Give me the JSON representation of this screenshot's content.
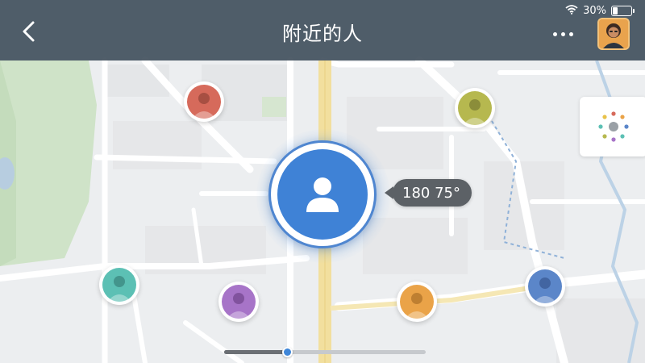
{
  "status_bar": {
    "signal_icon": "wifi-icon",
    "battery_text": "30%",
    "battery_level": 0.3
  },
  "header": {
    "title": "附近的人",
    "back_icon": "chevron-left-icon",
    "more_icon": "more-dots-icon",
    "avatar": "profile-avatar"
  },
  "map": {
    "side_button_icon": "people-radar-icon",
    "self_marker": {
      "icon": "person-icon",
      "color": "#3f82d6",
      "bubble_text": "180 75°"
    },
    "people": [
      {
        "id": "red",
        "color": "#d66a5b"
      },
      {
        "id": "olive",
        "color": "#b6b84f"
      },
      {
        "id": "teal",
        "color": "#5cc0b4"
      },
      {
        "id": "purple",
        "color": "#a774c8"
      },
      {
        "id": "orange",
        "color": "#eaa348"
      },
      {
        "id": "blue",
        "color": "#5b86c9"
      }
    ]
  },
  "slider": {
    "value": 0.31
  }
}
